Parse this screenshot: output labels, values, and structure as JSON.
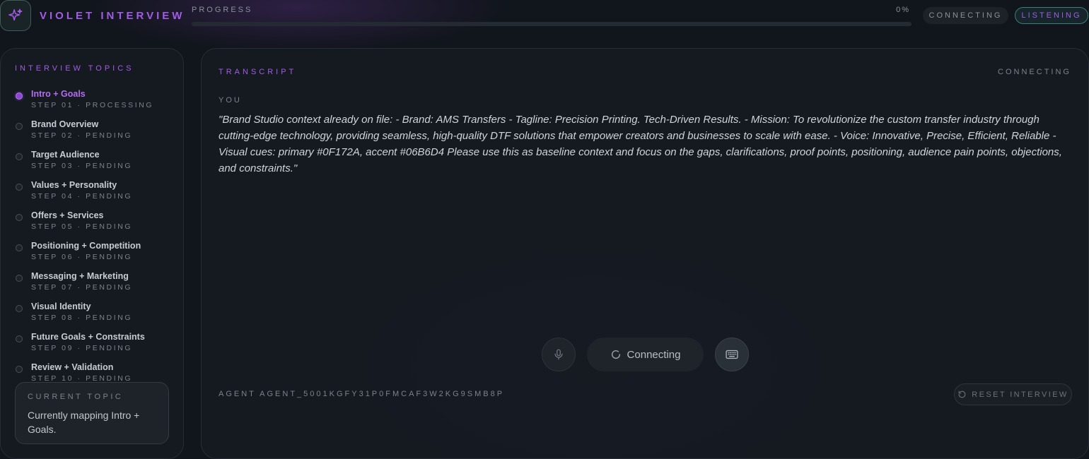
{
  "header": {
    "brand": "VIOLET INTERVIEW",
    "logo_icon": "sparkle-icon",
    "progress_label": "PROGRESS",
    "progress_percent_text": "0%",
    "progress_fraction": 0,
    "status_pill": "CONNECTING",
    "mode_pill": "LISTENING"
  },
  "sidebar": {
    "title": "INTERVIEW TOPICS",
    "topics": [
      {
        "title": "Intro + Goals",
        "step": "STEP 01 · PROCESSING",
        "active": true
      },
      {
        "title": "Brand Overview",
        "step": "STEP 02 · PENDING",
        "active": false
      },
      {
        "title": "Target Audience",
        "step": "STEP 03 · PENDING",
        "active": false
      },
      {
        "title": "Values + Personality",
        "step": "STEP 04 · PENDING",
        "active": false
      },
      {
        "title": "Offers + Services",
        "step": "STEP 05 · PENDING",
        "active": false
      },
      {
        "title": "Positioning + Competition",
        "step": "STEP 06 · PENDING",
        "active": false
      },
      {
        "title": "Messaging + Marketing",
        "step": "STEP 07 · PENDING",
        "active": false
      },
      {
        "title": "Visual Identity",
        "step": "STEP 08 · PENDING",
        "active": false
      },
      {
        "title": "Future Goals + Constraints",
        "step": "STEP 09 · PENDING",
        "active": false
      },
      {
        "title": "Review + Validation",
        "step": "STEP 10 · PENDING",
        "active": false
      }
    ],
    "current_topic": {
      "label": "CURRENT TOPIC",
      "text": "Currently mapping Intro + Goals."
    }
  },
  "transcript": {
    "title": "TRANSCRIPT",
    "status": "CONNECTING",
    "speaker": "YOU",
    "message": "\"Brand Studio context already on file: - Brand: AMS Transfers - Tagline: Precision Printing. Tech-Driven Results. - Mission: To revolutionize the custom transfer industry through cutting-edge technology, providing seamless, high-quality DTF solutions that empower creators and businesses to scale with ease. - Voice: Innovative, Precise, Efficient, Reliable - Visual cues: primary #0F172A, accent #06B6D4 Please use this as baseline context and focus on the gaps, clarifications, proof points, positioning, audience pain points, objections, and constraints.\""
  },
  "controls": {
    "mic_icon": "microphone-icon",
    "connect_label": "Connecting",
    "spinner_icon": "spinner-icon",
    "keyboard_icon": "keyboard-icon"
  },
  "footer": {
    "agent_id": "AGENT AGENT_5001KGFY31P0FMCAF3W2KG9SMB8P",
    "reset_label": "RESET INTERVIEW",
    "reset_icon": "reset-icon"
  },
  "colors": {
    "accent": "#a35ce6",
    "teal_border": "#3d7f78",
    "background": "#11151c"
  }
}
